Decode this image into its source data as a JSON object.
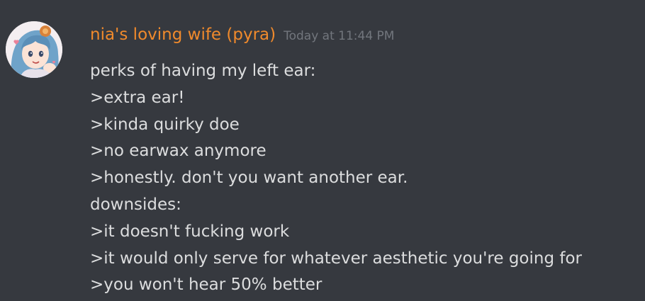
{
  "message": {
    "author": "nia's loving wife (pyra)",
    "timestamp": "Today at 11:44 PM",
    "avatar_icon": "anime-girl-avatar",
    "author_color": "#f08a2c",
    "lines": [
      "perks of having my left ear:",
      ">extra ear!",
      ">kinda quirky doe",
      ">no earwax anymore",
      ">honestly. don't you want another ear.",
      "downsides:",
      ">it doesn't fucking work",
      ">it would only serve for whatever aesthetic you're going for",
      ">you won't hear 50% better"
    ]
  }
}
